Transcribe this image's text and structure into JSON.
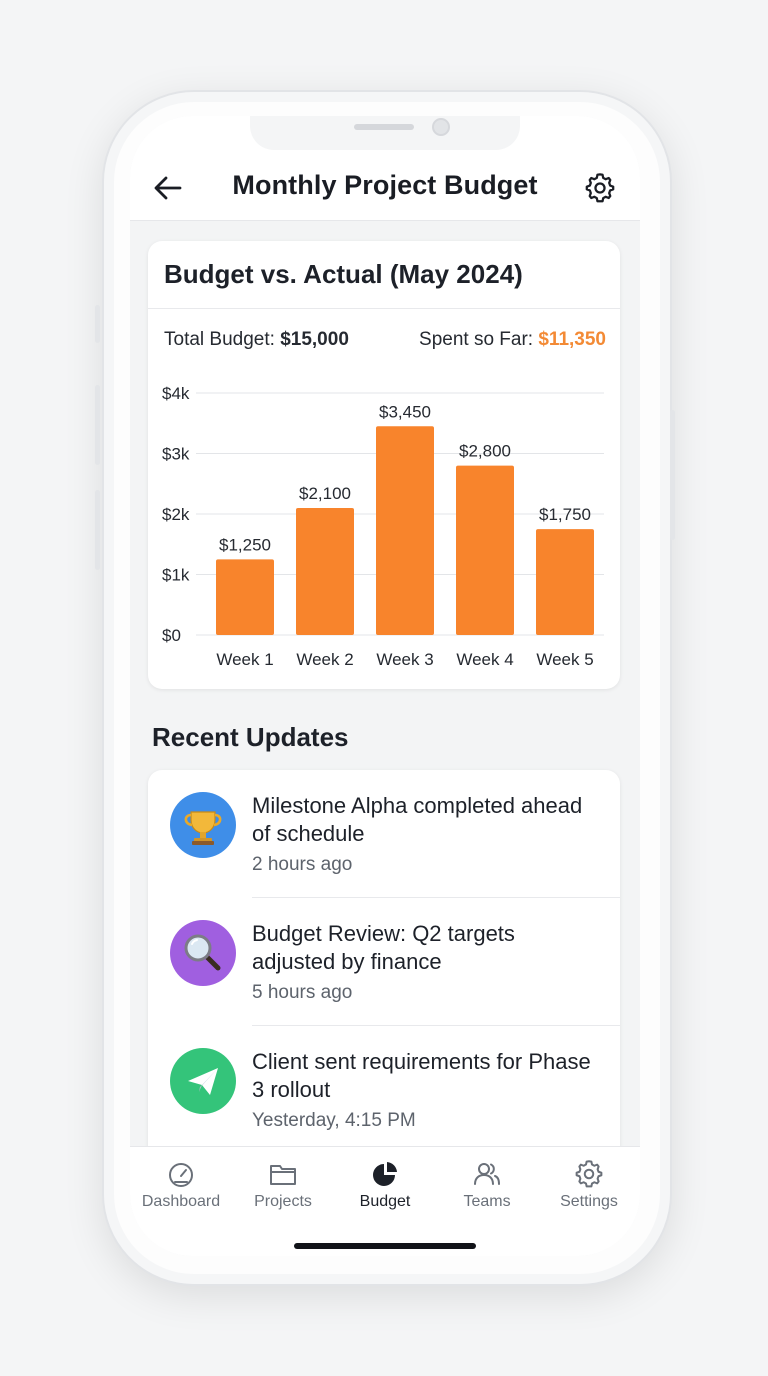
{
  "header": {
    "title": "Monthly Project Budget",
    "back_icon": "arrow-left-icon",
    "settings_icon": "gear-icon"
  },
  "budget_card": {
    "title": "Budget vs. Actual (May 2024)",
    "total_label": "Total Budget:",
    "total_value": "$15,000",
    "spent_label": "Spent so Far:",
    "spent_value": "$11,350"
  },
  "colors": {
    "bar": "#f8842c",
    "accent": "#f38a35",
    "grid": "#e3e5e8",
    "trophy_bg": "#3f8ee8",
    "magnifier_bg": "#a05fe0",
    "send_bg": "#34c47a"
  },
  "chart_data": {
    "type": "bar",
    "categories": [
      "Week 1",
      "Week 2",
      "Week 3",
      "Week 4",
      "Week 5"
    ],
    "values": [
      1250,
      2100,
      3450,
      2800,
      1750
    ],
    "value_labels": [
      "$1,250",
      "$2,100",
      "$3,450",
      "$2,800",
      "$1,750"
    ],
    "y_ticks": [
      0,
      1000,
      2000,
      3000,
      4000
    ],
    "y_tick_labels": [
      "$0",
      "$1k",
      "$2k",
      "$3k",
      "$4k"
    ],
    "ylim": [
      0,
      4000
    ],
    "grid": true
  },
  "updates_section": {
    "title": "Recent Updates",
    "items": [
      {
        "title": "Milestone Alpha completed ahead of schedule",
        "time": "2 hours ago",
        "icon": "trophy-icon"
      },
      {
        "title": "Budget Review: Q2 targets adjusted by finance",
        "time": "5 hours ago",
        "icon": "magnifier-icon"
      },
      {
        "title": "Client sent requirements for Phase 3 rollout",
        "time": "Yesterday, 4:15 PM",
        "icon": "paper-plane-icon"
      }
    ]
  },
  "tabbar": {
    "active": "Budget",
    "items": [
      {
        "label": "Dashboard",
        "icon": "gauge-icon"
      },
      {
        "label": "Projects",
        "icon": "folder-icon"
      },
      {
        "label": "Budget",
        "icon": "pie-chart-icon"
      },
      {
        "label": "Teams",
        "icon": "users-icon"
      },
      {
        "label": "Settings",
        "icon": "gear-icon"
      }
    ]
  }
}
